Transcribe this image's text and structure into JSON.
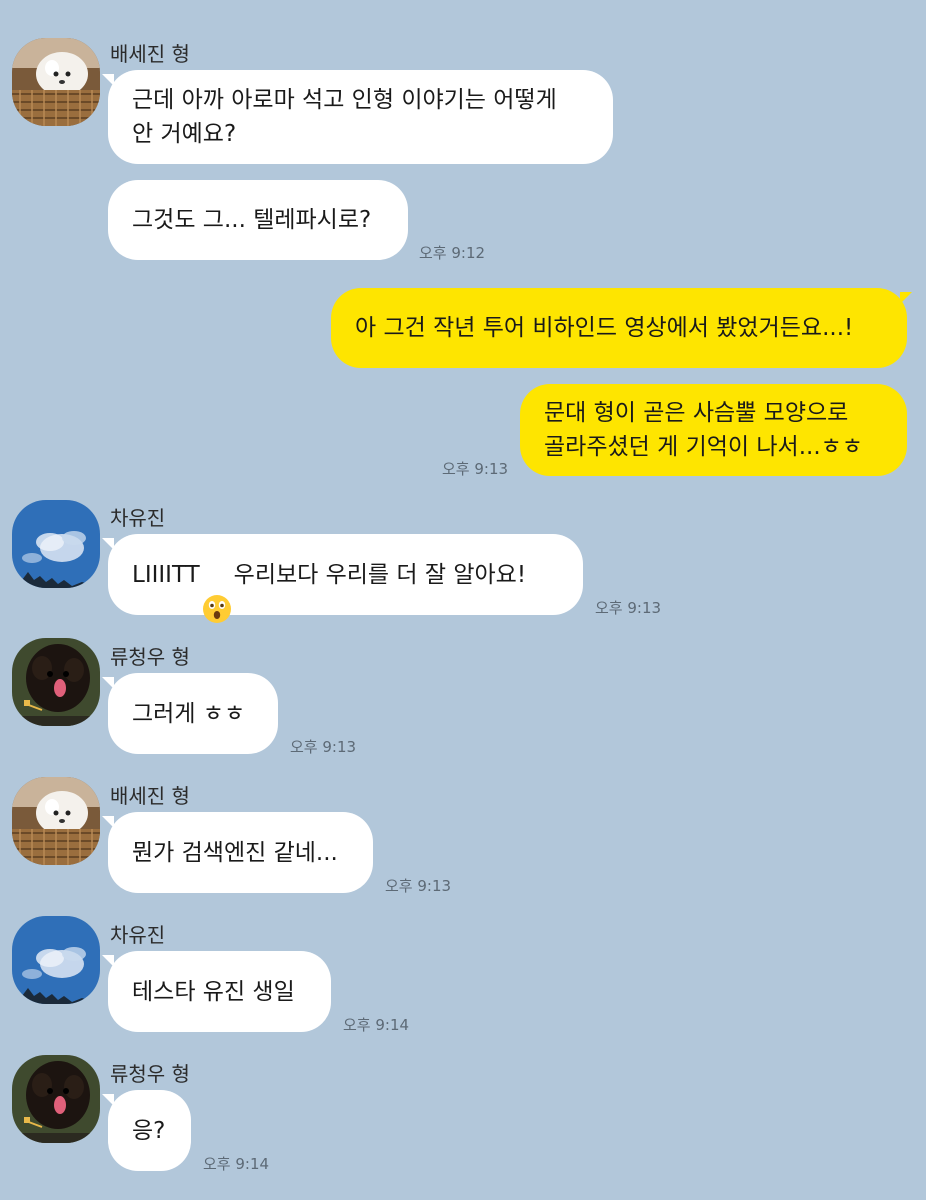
{
  "chat": {
    "groups": [
      {
        "sender": "배세진 형",
        "avatar_icon": "white-dog-in-basket-avatar",
        "messages": [
          {
            "text": "근데 아까 아로마 석고 인형 이야기는 어떻게\n안 거예요?",
            "time": ""
          },
          {
            "text": "그것도 그... 텔레파시로?",
            "time": "오후 9:12"
          }
        ]
      },
      {
        "sender": "me",
        "messages": [
          {
            "text": "아 그건 작년 투어 비하인드 영상에서 봤었거든요...!",
            "time": ""
          },
          {
            "text": "문대 형이 곧은 사슴뿔 모양으로\n골라주셨던 게 기억이 나서...ㅎㅎ",
            "time": "오후 9:13"
          }
        ]
      },
      {
        "sender": "차유진",
        "avatar_icon": "blue-sky-clouds-avatar",
        "messages": [
          {
            "text_before": "LIIIITT",
            "emoji": "astonished-face-emoji",
            "text_after": "우리보다 우리를 더 잘 알아요!",
            "time": "오후 9:13"
          }
        ]
      },
      {
        "sender": "류청우 형",
        "avatar_icon": "black-poodle-avatar",
        "messages": [
          {
            "text": "그러게 ㅎㅎ",
            "time": "오후 9:13"
          }
        ]
      },
      {
        "sender": "배세진 형",
        "avatar_icon": "white-dog-in-basket-avatar",
        "messages": [
          {
            "text": "뭔가 검색엔진 같네...",
            "time": "오후 9:13"
          }
        ]
      },
      {
        "sender": "차유진",
        "avatar_icon": "blue-sky-clouds-avatar",
        "messages": [
          {
            "text": "테스타 유진 생일",
            "time": "오후 9:14"
          }
        ]
      },
      {
        "sender": "류청우 형",
        "avatar_icon": "black-poodle-avatar",
        "messages": [
          {
            "text": "응?",
            "time": "오후 9:14"
          }
        ]
      }
    ]
  },
  "colors": {
    "background": "#b2c7da",
    "incoming_bubble": "#ffffff",
    "outgoing_bubble": "#fee500"
  }
}
